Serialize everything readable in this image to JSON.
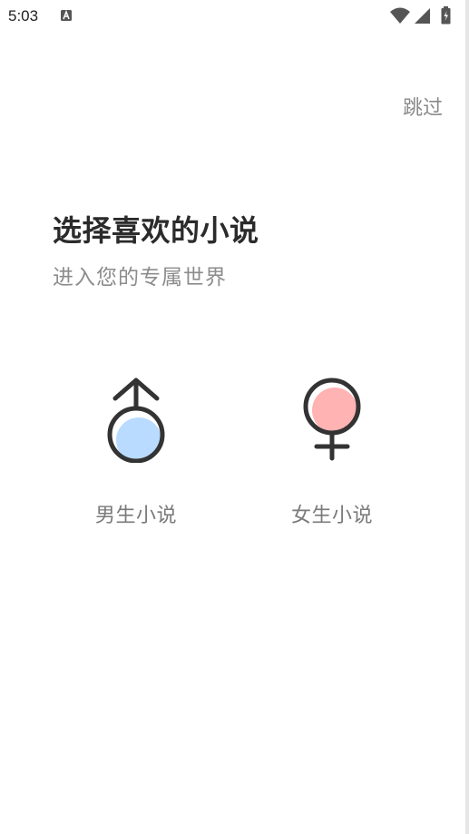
{
  "status_bar": {
    "time": "5:03",
    "notification_icon": "a-letter-icon",
    "icons": [
      "wifi-icon",
      "signal-icon",
      "battery-icon"
    ]
  },
  "header": {
    "skip_label": "跳过"
  },
  "intro": {
    "title": "选择喜欢的小说",
    "subtitle": "进入您的专属世界"
  },
  "options": {
    "male": {
      "label": "男生小说",
      "icon": "male-symbol-icon",
      "fill_color": "#b9dbff"
    },
    "female": {
      "label": "女生小说",
      "icon": "female-symbol-icon",
      "fill_color": "#ffb3b3"
    }
  },
  "colors": {
    "stroke": "#333333",
    "title_text": "#2b2b2b",
    "muted_text": "#8c8c8c"
  }
}
